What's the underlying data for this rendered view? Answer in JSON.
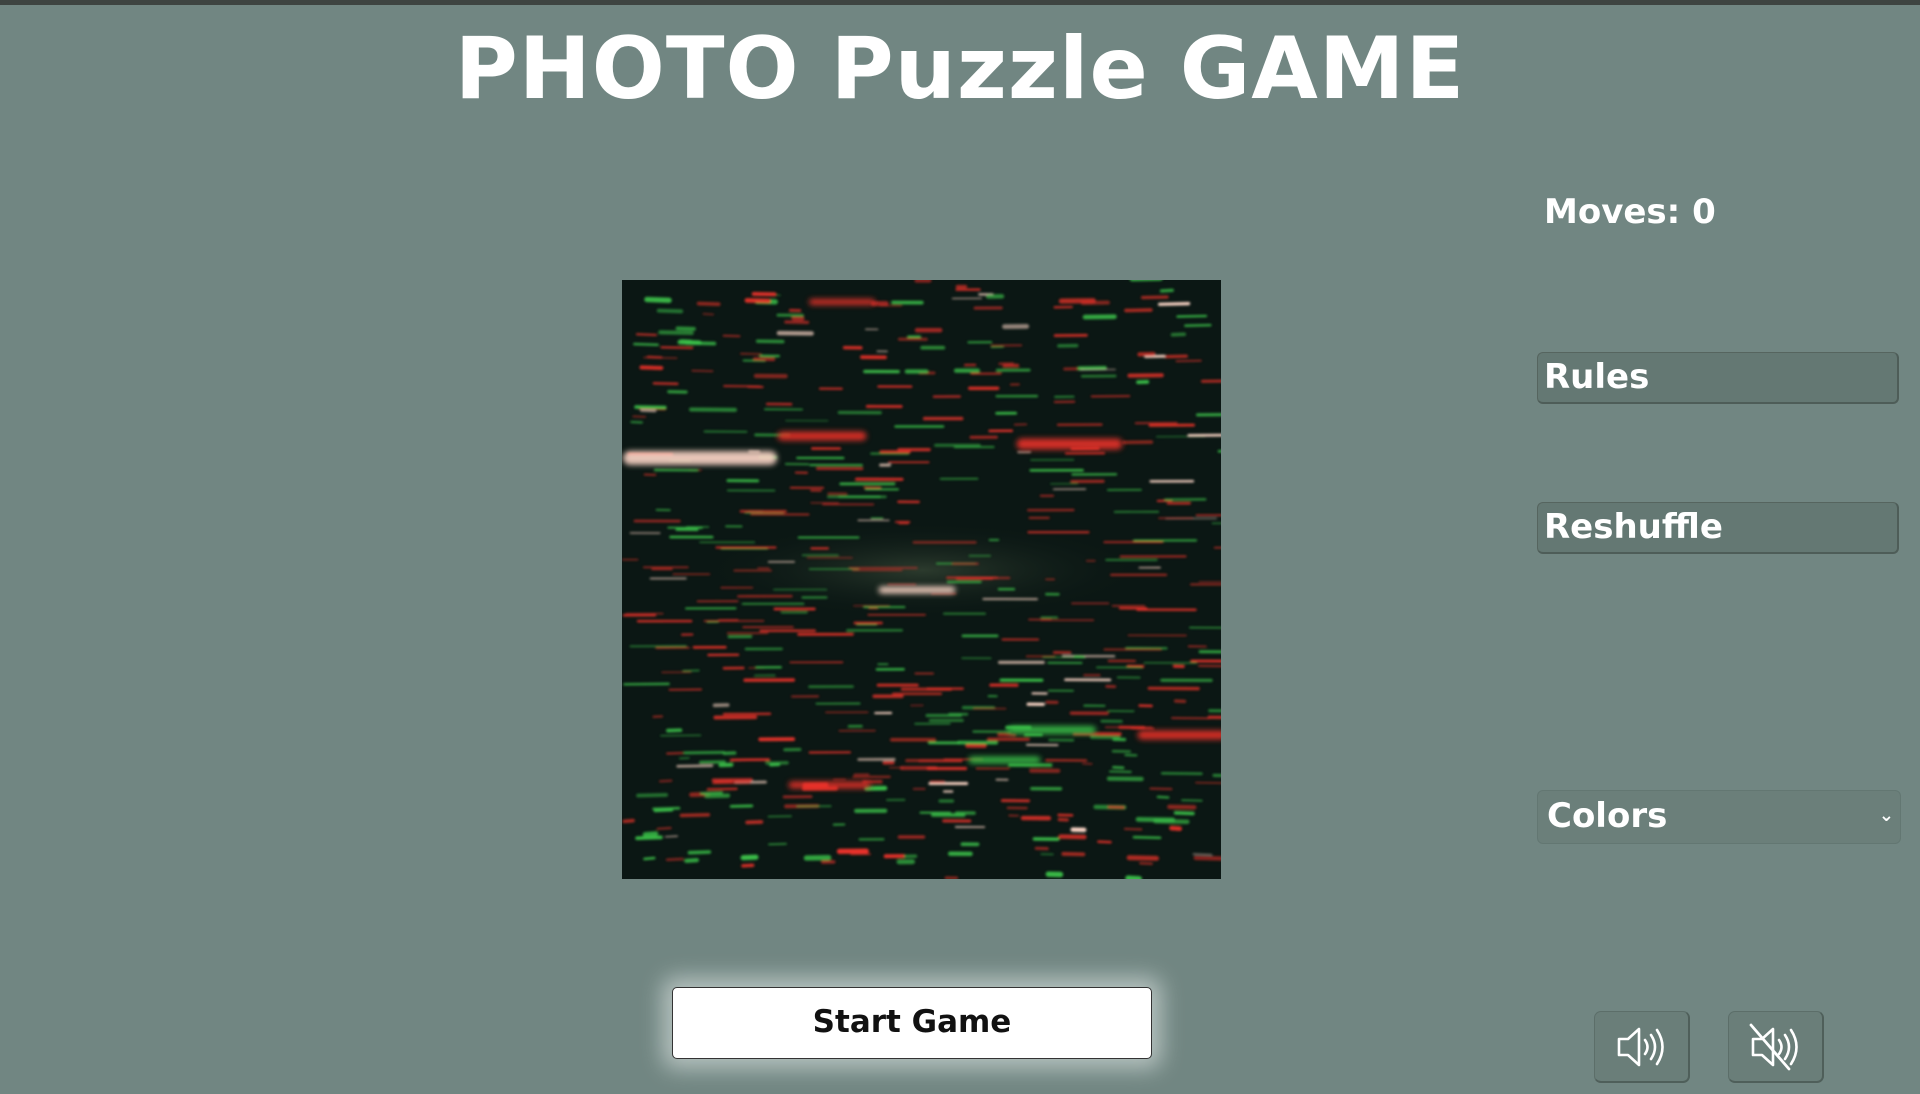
{
  "title": "PHOTO Puzzle GAME",
  "puzzle": {
    "image_icon": "light-streaks-photo",
    "colors": {
      "background": "#0b1714",
      "red": "#e8322a",
      "green": "#3cc24a",
      "glow": "#ffd9c9"
    }
  },
  "sidebar": {
    "moves_label": "Moves: 0",
    "rules_label": "Rules",
    "reshuffle_label": "Reshuffle",
    "colors_select": {
      "selected": "Colors",
      "icon": "chevron-down-icon"
    }
  },
  "controls": {
    "start_label": "Start Game",
    "sound_on_icon": "speaker-on-icon",
    "sound_off_icon": "speaker-muted-icon"
  },
  "colors": {
    "background": "#718682",
    "button_bg": "#647873",
    "start_bg": "#ffffff"
  }
}
